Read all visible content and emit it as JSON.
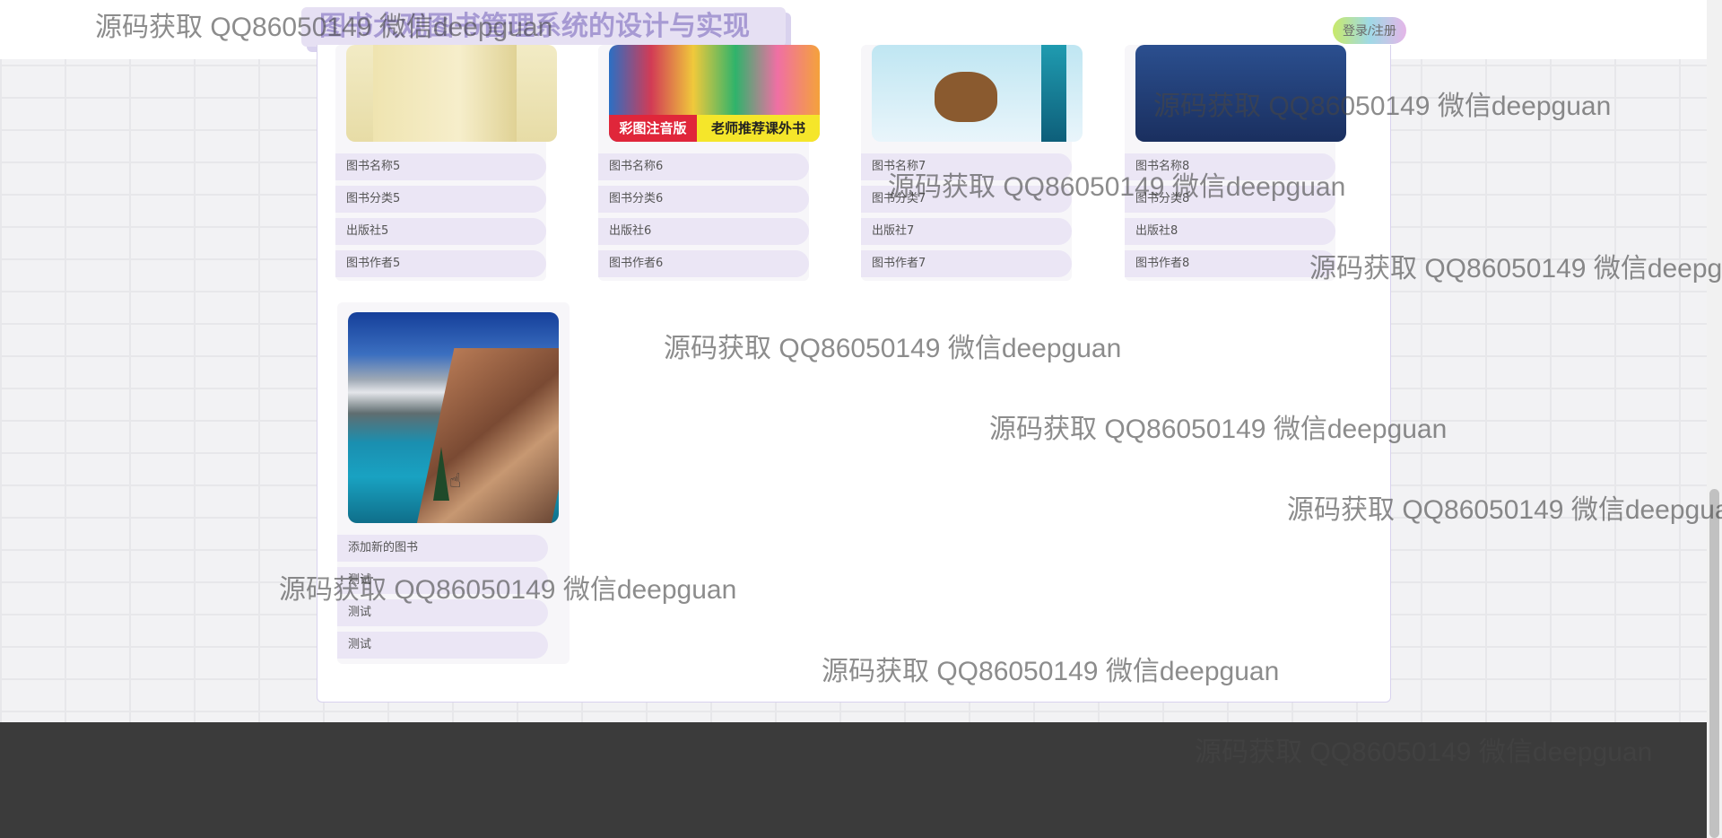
{
  "header": {
    "site_title": "图书大观图书管理系统的设计与实现",
    "login_label": "登录/注册"
  },
  "books": [
    {
      "name": "图书名称5",
      "category": "图书分类5",
      "publisher": "出版社5",
      "author": "图书作者5"
    },
    {
      "name": "图书名称6",
      "category": "图书分类6",
      "publisher": "出版社6",
      "author": "图书作者6",
      "cover_badges": [
        "彩图注音版",
        "老师推荐课外书"
      ]
    },
    {
      "name": "图书名称7",
      "category": "图书分类7",
      "publisher": "出版社7",
      "author": "图书作者7"
    },
    {
      "name": "图书名称8",
      "category": "图书分类8",
      "publisher": "出版社8",
      "author": "图书作者8"
    }
  ],
  "new_book": {
    "name": "添加新的图书",
    "category": "测试",
    "publisher": "测试",
    "author": "测试"
  },
  "watermark": "源码获取 QQ86050149 微信deepguan"
}
